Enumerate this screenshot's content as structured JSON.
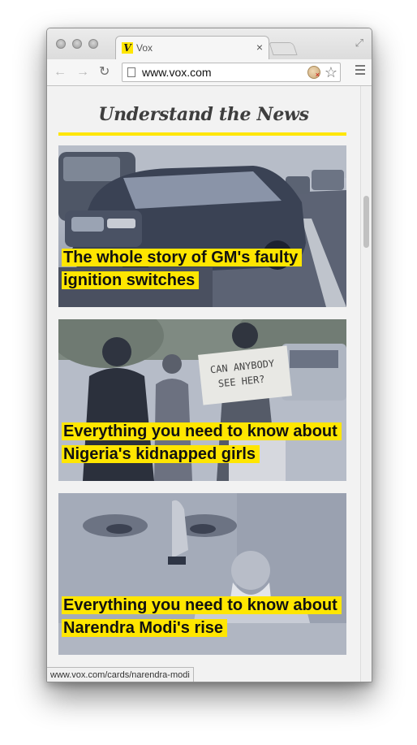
{
  "browser": {
    "tab_title": "Vox",
    "tab_favicon": "V",
    "tab_close": "×",
    "url": "www.vox.com",
    "back_icon": "←",
    "forward_icon": "→",
    "reload_icon": "↻",
    "star_icon": "☆",
    "fullscreen_icon": "⤢",
    "status_url": "www.vox.com/cards/narendra-modi"
  },
  "section": {
    "title": "Understand the News",
    "accent_color": "#ffe600"
  },
  "cards": [
    {
      "title": "The whole story of GM's faulty ignition switches",
      "image": "cars-photo"
    },
    {
      "title": "Everything you need to know about Nigeria's kidnapped girls",
      "image": "protest-photo"
    },
    {
      "title": "Everything you need to know about Narendra Modi's rise",
      "image": "modi-photo"
    }
  ]
}
